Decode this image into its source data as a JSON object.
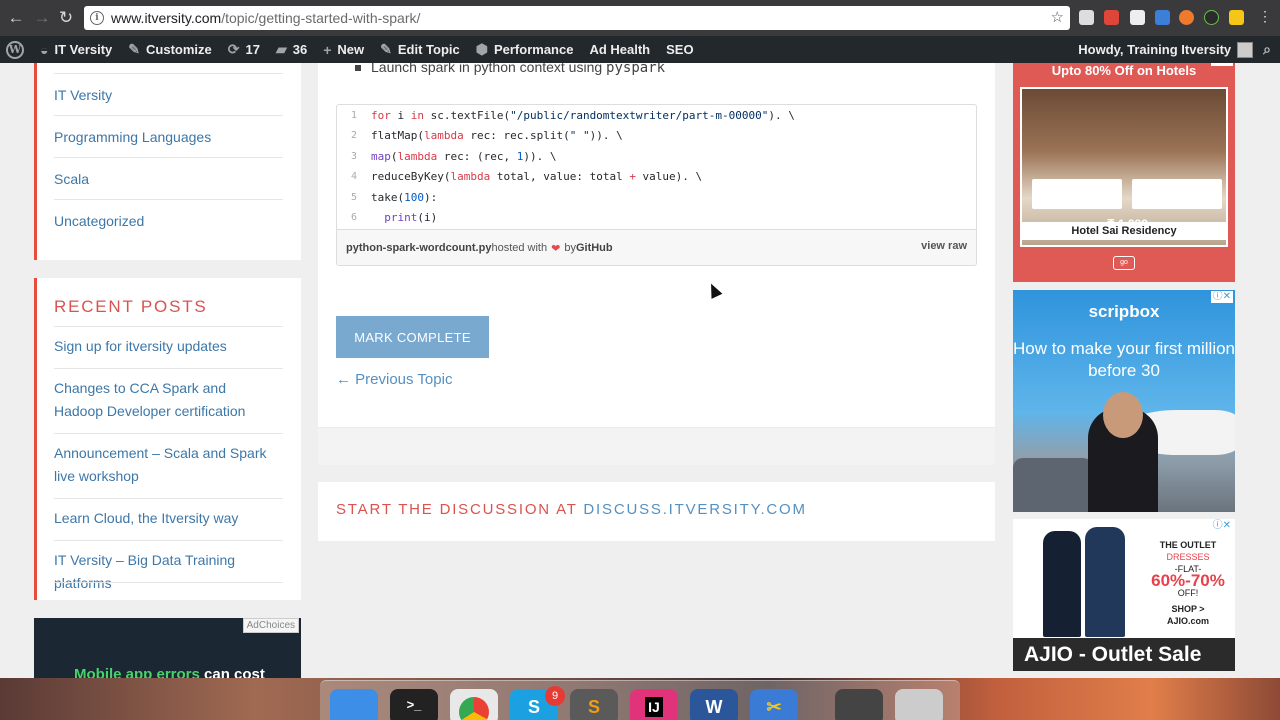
{
  "browser": {
    "back_icon": "←",
    "forward_icon": "→",
    "reload_icon": "↻",
    "url_host": "www.itversity.com",
    "url_path": "/topic/getting-started-with-spark/",
    "star_icon": "☆",
    "menu_icon": "⋮"
  },
  "adminbar": {
    "site_name": "IT Versity",
    "customize": "Customize",
    "updates_count": "17",
    "comments_count": "36",
    "new_label": "New",
    "edit_topic": "Edit Topic",
    "performance": "Performance",
    "ad_health": "Ad Health",
    "seo": "SEO",
    "howdy": "Howdy, Training Itversity"
  },
  "sidebar": {
    "categories": [
      "IT Versity",
      "Programming Languages",
      "Scala",
      "Uncategorized"
    ],
    "recent_posts_title": "RECENT POSTS",
    "recent_posts": [
      "Sign up for itversity updates",
      "Changes to CCA Spark and Hadoop Developer certification",
      "Announcement – Scala and Spark live workshop",
      "Learn Cloud, the Itversity way",
      "IT Versity – Big Data Training platforms"
    ],
    "ad_choices": "AdChoices",
    "ad_text_green": "Mobile app errors",
    "ad_text_white": " can cost"
  },
  "main": {
    "bullet_text": "Launch spark in python context using ",
    "bullet_code": "pyspark",
    "gist": {
      "line_numbers": [
        "1",
        "2",
        "3",
        "4",
        "5",
        "6"
      ],
      "filename": "python-spark-wordcount.py",
      "hosted_with": " hosted with ",
      "heart": "❤",
      "by": " by ",
      "github": "GitHub",
      "view_raw": "view raw"
    },
    "mark_complete": "MARK COMPLETE",
    "previous_topic": "← Previous Topic",
    "discussion_prefix": "START THE DISCUSSION AT ",
    "discussion_link": "DISCUSS.ITVERSITY.COM"
  },
  "right_ads": {
    "hotel_title": "Upto 80% Off on Hotels",
    "hotel_price": "₹ 1,999",
    "hotel_name": "Hotel Sai Residency",
    "scripbox_logo": "scripbox",
    "scripbox_text": "How to make your first million before 30",
    "outlet_label": "THE OUTLET",
    "outlet_dresses": "DRESSES",
    "outlet_flat": "-FLAT-",
    "outlet_discount": "60%-70%",
    "outlet_off": "OFF!",
    "outlet_shop": "SHOP >",
    "outlet_ajio": "AJIO.com",
    "ajio_banner": "AJIO - Outlet Sale"
  },
  "dock": {
    "skype_badge": "9"
  },
  "colors": {
    "accent_red": "#e74c3c",
    "link_blue": "#3d77a8",
    "button_blue": "#7aa9d0",
    "admin_bar": "#23282d"
  }
}
